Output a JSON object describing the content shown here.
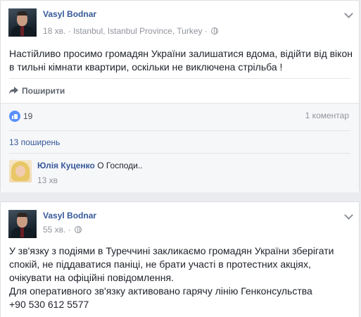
{
  "posts": [
    {
      "author": "Vasyl Bodnar",
      "time": "18 хв.",
      "separator": "·",
      "location": "Istanbul, Istanbul Province, Turkey",
      "text": "Настійливо просимо громадян України залишатися вдома, відійти від вікон в тильні кімнати квартири, оскільки не виключена стрільба !",
      "share_label": "Поширити",
      "likes": "19",
      "comments_count": "1 коментар",
      "shares": "13 поширень",
      "comment": {
        "author": "Юлія Куценко",
        "text": "О Господи..",
        "time": "13 хв"
      }
    },
    {
      "author": "Vasyl Bodnar",
      "time": "55 хв.",
      "separator": "·",
      "text_lines": [
        "У зв'язку з подіями в Туреччині закликаємо громадян України зберігати",
        "спокій, не піддаватися паніці, не брати участі в протестних акціях,",
        "очікувати на офіційні повідомлення.",
        "Для оперативного зв'язку активовано гарячу лінію Генконсульства",
        "+90 530 612 5577"
      ]
    }
  ],
  "colors": {
    "link": "#365899",
    "secondary_text": "#90949c",
    "like_blue": "#5890ff",
    "background": "#e9ebee"
  },
  "icons": [
    "globe-icon",
    "chevron-down-icon",
    "share-arrow-icon",
    "like-icon"
  ]
}
